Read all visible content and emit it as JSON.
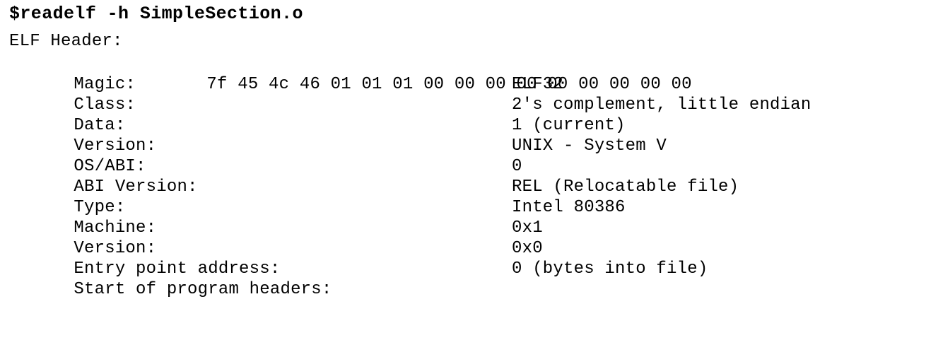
{
  "command": "$readelf -h SimpleSection.o",
  "header_title": "ELF Header:",
  "magic": {
    "label": "Magic:",
    "value": "7f 45 4c 46 01 01 01 00 00 00 00 00 00 00 00 00"
  },
  "fields": [
    {
      "label": "Class:",
      "value": "ELF32"
    },
    {
      "label": "Data:",
      "value": "2's complement, little endian"
    },
    {
      "label": "Version:",
      "value": "1 (current)"
    },
    {
      "label": "OS/ABI:",
      "value": "UNIX - System V"
    },
    {
      "label": "ABI Version:",
      "value": "0"
    },
    {
      "label": "Type:",
      "value": "REL (Relocatable file)"
    },
    {
      "label": "Machine:",
      "value": "Intel 80386"
    },
    {
      "label": "Version:",
      "value": "0x1"
    },
    {
      "label": "Entry point address:",
      "value": "0x0"
    },
    {
      "label": "Start of program headers:",
      "value": "0 (bytes into file)"
    }
  ]
}
